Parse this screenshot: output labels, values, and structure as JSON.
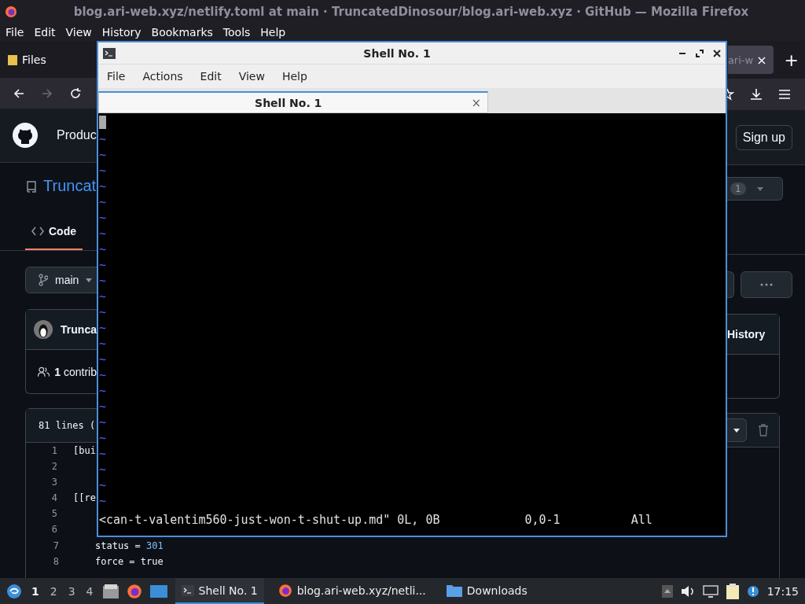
{
  "browser": {
    "title": "blog.ari-web.xyz/netlify.toml at main · TruncatedDinosour/blog.ari-web.xyz · GitHub — Mozilla Firefox",
    "menu": [
      "File",
      "Edit",
      "View",
      "History",
      "Bookmarks",
      "Tools",
      "Help"
    ],
    "bookmark": "Files",
    "tab": {
      "label": "ari-w",
      "close": "×"
    },
    "new_tab": "+",
    "forward_disabled": true,
    "page": {
      "header_link": "Produc",
      "signup": "Sign up",
      "repo": "Truncat",
      "badge": "1",
      "code_tab": {
        "label": "Code",
        "selected": true
      },
      "branch": "main",
      "commit_author": "Trunca",
      "history": "History",
      "contributors": {
        "count": "1",
        "label": "contrib"
      },
      "file_info": "81 lines (",
      "lines": [
        {
          "number": "1",
          "tokens": [
            {
              "text": "[bui",
              "kind": "plain"
            }
          ]
        },
        {
          "number": "2"
        },
        {
          "number": "3"
        },
        {
          "number": "4",
          "tokens": [
            {
              "text": "[[re",
              "kind": "plain"
            }
          ]
        },
        {
          "number": "5"
        },
        {
          "number": "6"
        }
      ],
      "lower_lines": [
        {
          "number": "7",
          "tokens": [
            {
              "text": "status = ",
              "kind": "plain"
            },
            {
              "text": "301",
              "kind": "number"
            }
          ]
        },
        {
          "number": "8",
          "tokens": [
            {
              "text": "force = true",
              "kind": "plain"
            }
          ]
        }
      ]
    }
  },
  "terminal": {
    "title": "Shell No. 1",
    "menu": [
      "File",
      "Actions",
      "Edit",
      "View",
      "Help"
    ],
    "tabs": [
      {
        "label": "Shell No. 1",
        "selected": true,
        "close": "×"
      }
    ],
    "tilde_lines": [
      "~",
      "~",
      "~",
      "~",
      "~",
      "~",
      "~",
      "~",
      "~",
      "~",
      "~",
      "~",
      "~",
      "~",
      "~",
      "~",
      "~",
      "~",
      "~",
      "~",
      "~",
      "~",
      "~",
      "~"
    ],
    "status_line": {
      "message": "<can-t-valentim560-just-won-t-shut-up.md\" 0L, 0B",
      "position": "0,0-1",
      "scroll": "All"
    }
  },
  "taskbar": {
    "workspaces": [
      {
        "label": "1",
        "selected": true
      },
      {
        "label": "2",
        "selected": false
      },
      {
        "label": "3",
        "selected": false
      },
      {
        "label": "4",
        "selected": false
      }
    ],
    "tasks": [
      {
        "label": "Shell No. 1",
        "kind": "terminal",
        "selected": true
      },
      {
        "label": "blog.ari-web.xyz/netli...",
        "kind": "browser",
        "selected": false
      },
      {
        "label": "Downloads",
        "kind": "folder",
        "selected": false
      }
    ],
    "clock": "17:15"
  }
}
